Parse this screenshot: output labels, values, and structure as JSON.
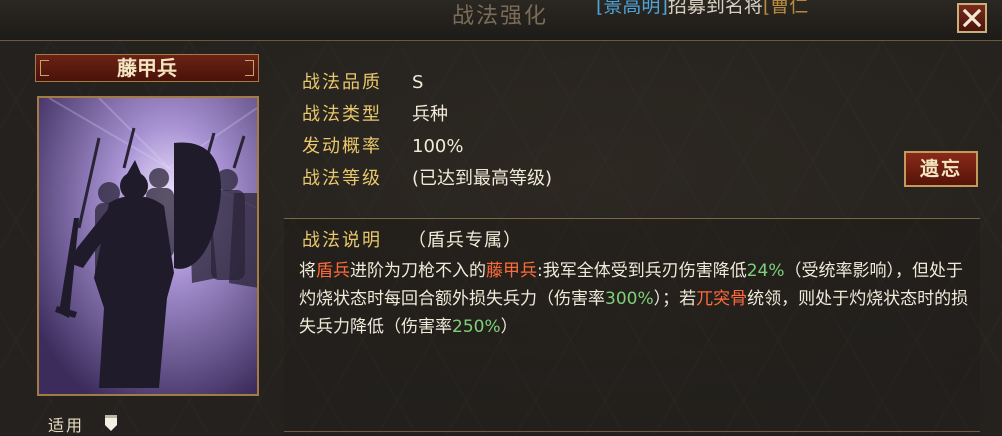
{
  "window": {
    "title": "战法强化",
    "marquee": {
      "bracket_open": "[",
      "name": "景高明",
      "bracket_close": "]",
      "text": "招募到名将",
      "hero_open": "[",
      "hero": "曹仁"
    }
  },
  "card": {
    "name": "藤甲兵",
    "apply_label": "适用"
  },
  "info": [
    {
      "key": "战法品质",
      "value": "S"
    },
    {
      "key": "战法类型",
      "value": "兵种"
    },
    {
      "key": "发动概率",
      "value": "100%"
    },
    {
      "key": "战法等级",
      "value": "(已达到最高等级)"
    }
  ],
  "buttons": {
    "forget": "遗忘"
  },
  "description": {
    "header": "战法说明",
    "tag": "（盾兵专属）",
    "parts": [
      {
        "t": "将",
        "c": ""
      },
      {
        "t": "盾兵",
        "c": "orange"
      },
      {
        "t": "进阶为刀枪不入的",
        "c": ""
      },
      {
        "t": "藤甲兵",
        "c": "orange"
      },
      {
        "t": ":我军全体受到兵刃伤害降低",
        "c": ""
      },
      {
        "t": "24%",
        "c": "green"
      },
      {
        "t": "（受统率影响），但处于灼烧状态时每回合额外损失兵力（伤害率",
        "c": ""
      },
      {
        "t": "300%",
        "c": "green"
      },
      {
        "t": "）；若",
        "c": ""
      },
      {
        "t": "兀突骨",
        "c": "orange"
      },
      {
        "t": "统领，则处于灼烧状态时的损失兵力降低（伤害率",
        "c": ""
      },
      {
        "t": "250%",
        "c": "green"
      },
      {
        "t": "）",
        "c": ""
      }
    ]
  },
  "icons": {
    "close": "close-icon",
    "apply": "shield-icon"
  },
  "colors": {
    "accent_gold": "#e9c76a",
    "highlight_orange": "#ff6a3a",
    "highlight_green": "#7fd07a",
    "button_red": "#8a2a18"
  }
}
